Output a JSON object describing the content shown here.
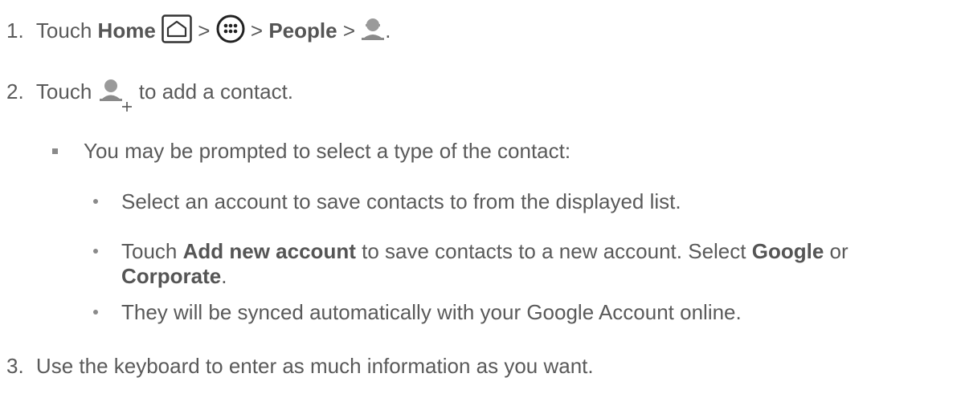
{
  "steps": [
    {
      "number": "1.",
      "touch": "Touch",
      "home": "Home",
      "sep1": ">",
      "sep2": ">",
      "people": "People",
      "sep3": ">",
      "end": "."
    },
    {
      "number": "2.",
      "touch": "Touch",
      "rest": "to add a contact."
    },
    {
      "number": "3.",
      "text": "Use the keyboard to enter as much information as you want."
    }
  ],
  "sub_bullet": "You may be prompted to select a type of the contact:",
  "sub_items": [
    {
      "text": "Select an account to save contacts to from the displayed list."
    },
    {
      "touch": "Touch",
      "add_new": "Add new account",
      "mid": "to save contacts to a new account.  Select",
      "google": "Google",
      "or": "or",
      "corporate": "Corporate",
      "end": "."
    },
    {
      "text": "They will be synced automatically with your Google Account online."
    }
  ],
  "icons": [
    "home-icon",
    "apps-icon",
    "add-contact-icon",
    "person-icon"
  ]
}
